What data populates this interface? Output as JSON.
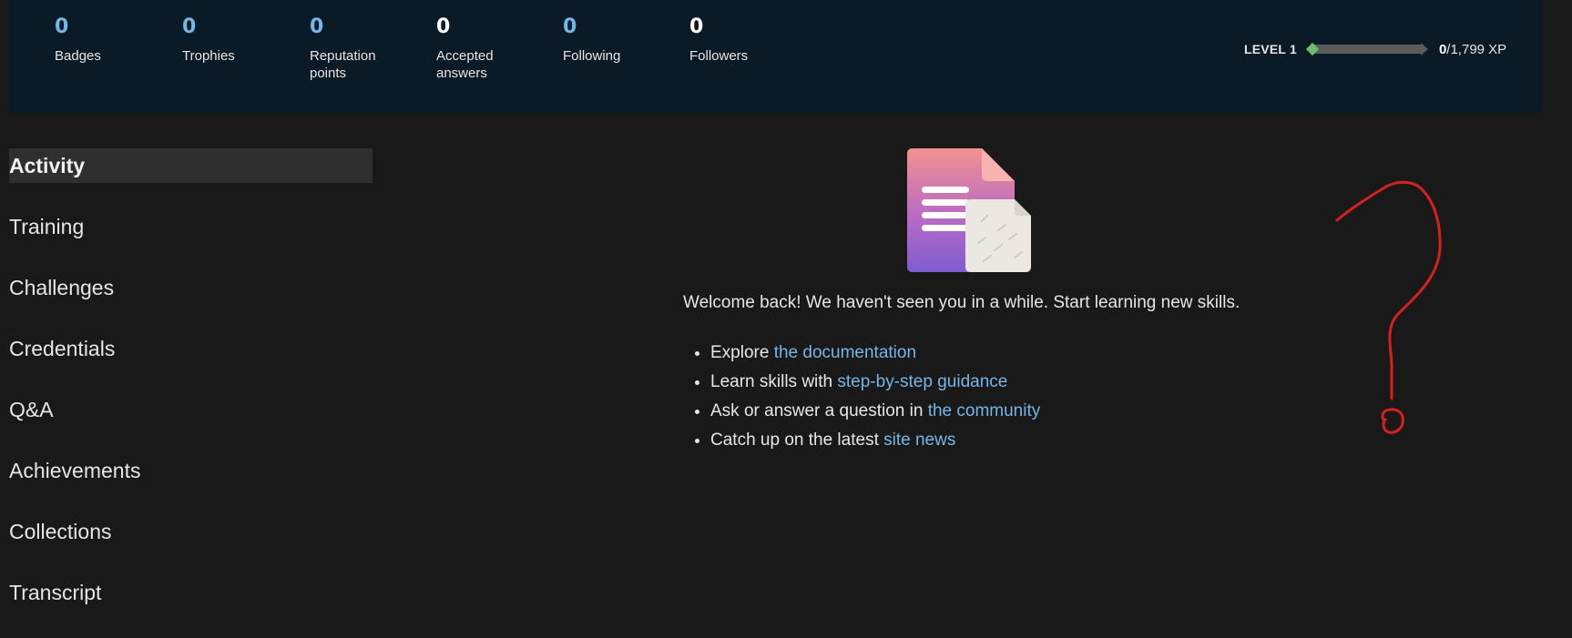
{
  "stats": [
    {
      "value": "0",
      "label": "Badges",
      "color": "#75b6e7"
    },
    {
      "value": "0",
      "label": "Trophies",
      "color": "#75b6e7"
    },
    {
      "value": "0",
      "label": "Reputation points",
      "color": "#75b6e7"
    },
    {
      "value": "0",
      "label": "Accepted answers",
      "color": "#ffffff"
    },
    {
      "value": "0",
      "label": "Following",
      "color": "#75b6e7"
    },
    {
      "value": "0",
      "label": "Followers",
      "color": "#ffffff"
    }
  ],
  "level": {
    "label": "LEVEL 1",
    "xp_current": "0",
    "xp_total": "/1,799 XP",
    "progress": 0
  },
  "nav": [
    {
      "label": "Activity",
      "active": true
    },
    {
      "label": "Training"
    },
    {
      "label": "Challenges"
    },
    {
      "label": "Credentials"
    },
    {
      "label": "Q&A"
    },
    {
      "label": "Achievements"
    },
    {
      "label": "Collections"
    },
    {
      "label": "Transcript"
    }
  ],
  "welcome": {
    "icon": "document-icon",
    "message": "Welcome back! We haven't seen you in a while. Start learning new skills.",
    "items": [
      {
        "prefix": "Explore ",
        "link": "the documentation"
      },
      {
        "prefix": "Learn skills with ",
        "link": "step-by-step guidance"
      },
      {
        "prefix": "Ask or answer a question in ",
        "link": "the community"
      },
      {
        "prefix": "Catch up on the latest ",
        "link": "site news"
      }
    ]
  },
  "annotation": {
    "icon": "question-mark-scribble",
    "color": "#d62020"
  },
  "colors": {
    "background": "#191919",
    "header": "#0b1a27",
    "link": "#75b6e7",
    "accent_green": "#6cbf6a"
  }
}
